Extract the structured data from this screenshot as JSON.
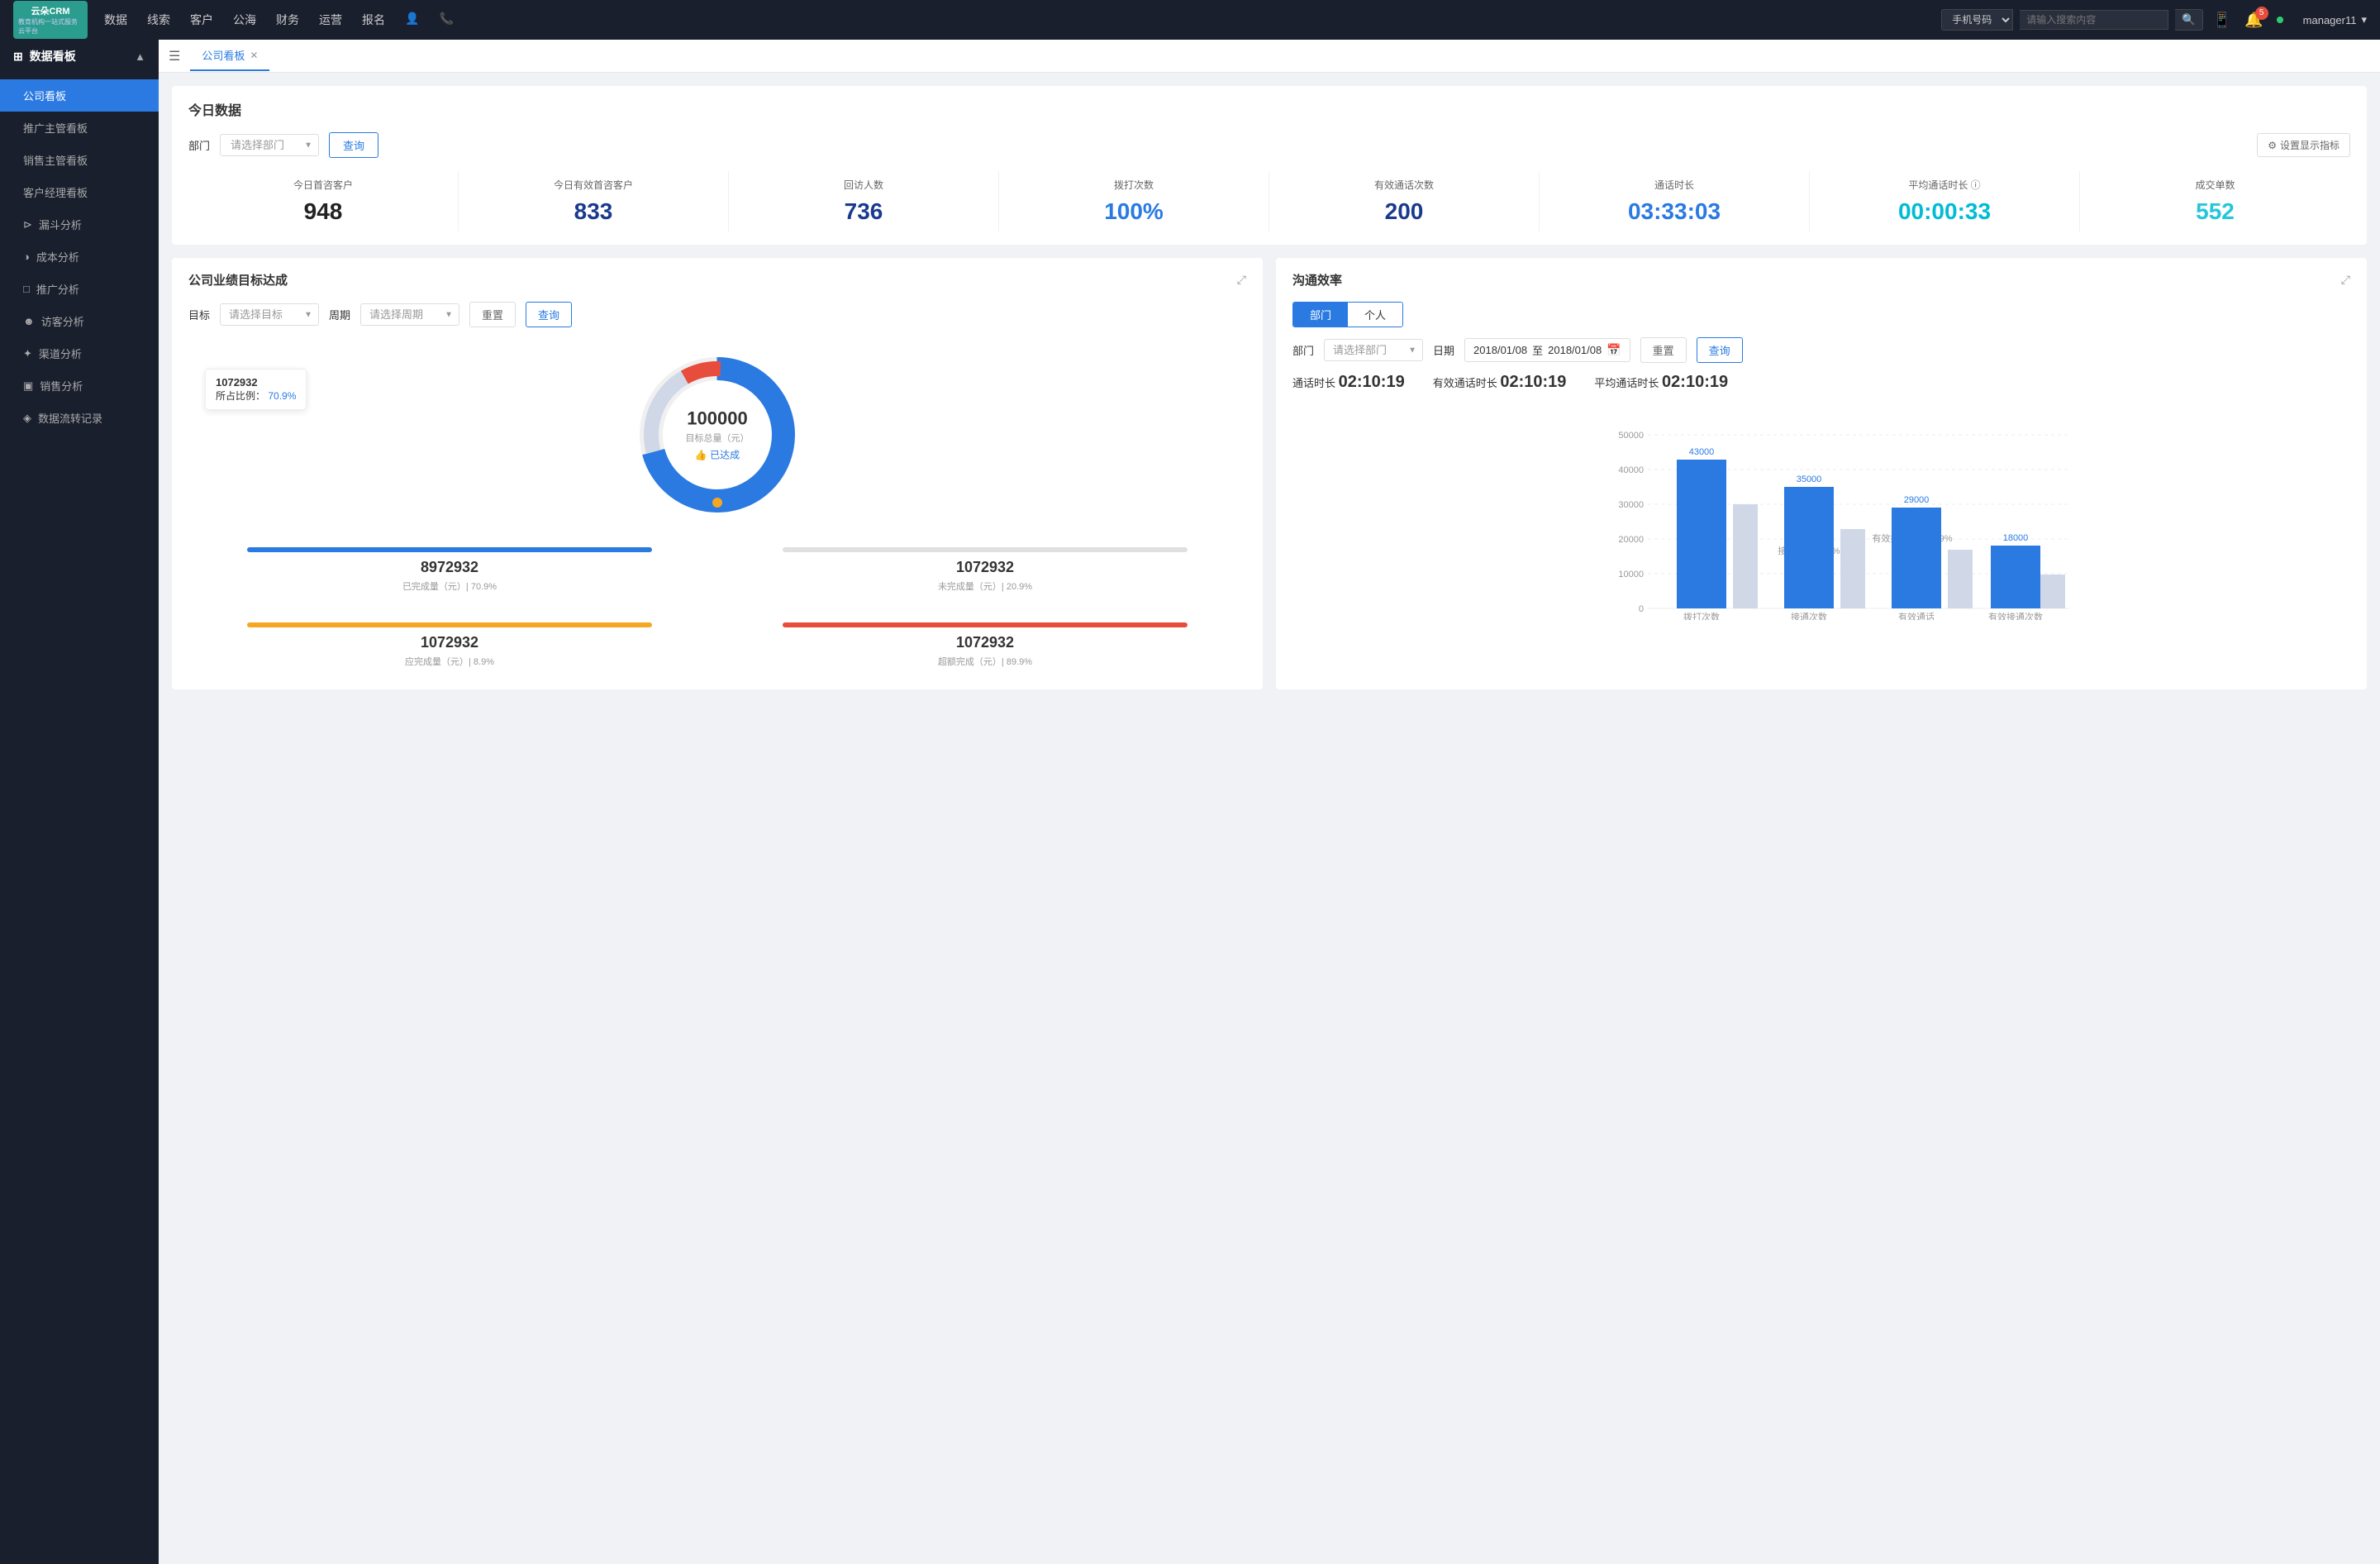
{
  "topNav": {
    "logo": {
      "text1": "云朵CRM",
      "text2": "教育机构一站式服务云平台"
    },
    "navItems": [
      "数据",
      "线索",
      "客户",
      "公海",
      "财务",
      "运营",
      "报名"
    ],
    "searchPlaceholder": "请输入搜索内容",
    "searchSelect": "手机号码",
    "notificationCount": "5",
    "username": "manager11"
  },
  "sidebar": {
    "sectionTitle": "数据看板",
    "items": [
      {
        "label": "公司看板",
        "active": true
      },
      {
        "label": "推广主管看板",
        "active": false
      },
      {
        "label": "销售主管看板",
        "active": false
      },
      {
        "label": "客户经理看板",
        "active": false
      },
      {
        "label": "漏斗分析",
        "active": false
      },
      {
        "label": "成本分析",
        "active": false
      },
      {
        "label": "推广分析",
        "active": false
      },
      {
        "label": "访客分析",
        "active": false
      },
      {
        "label": "渠道分析",
        "active": false
      },
      {
        "label": "销售分析",
        "active": false
      },
      {
        "label": "数据流转记录",
        "active": false
      }
    ]
  },
  "tab": {
    "label": "公司看板"
  },
  "todayData": {
    "sectionTitle": "今日数据",
    "filterLabel": "部门",
    "filterPlaceholder": "请选择部门",
    "queryBtn": "查询",
    "settingBtn": "设置显示指标",
    "metrics": [
      {
        "label": "今日首咨客户",
        "value": "948",
        "colorClass": "black"
      },
      {
        "label": "今日有效首咨客户",
        "value": "833",
        "colorClass": "blue-dark"
      },
      {
        "label": "回访人数",
        "value": "736",
        "colorClass": "blue-dark"
      },
      {
        "label": "拨打次数",
        "value": "100%",
        "colorClass": "blue"
      },
      {
        "label": "有效通话次数",
        "value": "200",
        "colorClass": "blue-dark"
      },
      {
        "label": "通话时长",
        "value": "03:33:03",
        "colorClass": "blue"
      },
      {
        "label": "平均通话时长",
        "value": "00:00:33",
        "colorClass": "cyan"
      },
      {
        "label": "成交单数",
        "value": "552",
        "colorClass": "teal"
      }
    ]
  },
  "goalPanel": {
    "title": "公司业绩目标达成",
    "filterGoalLabel": "目标",
    "filterGoalPlaceholder": "请选择目标",
    "filterPeriodLabel": "周期",
    "filterPeriodPlaceholder": "请选择周期",
    "resetBtn": "重置",
    "queryBtn": "查询",
    "donut": {
      "centerNum": "100000",
      "centerLabel": "目标总量（元）",
      "centerBadge": "👍 已达成",
      "tooltip": {
        "num": "1072932",
        "pctLabel": "所占比例：",
        "pct": "70.9%"
      },
      "segments": [
        {
          "color": "#2a7ae2",
          "pct": 70.9
        },
        {
          "color": "#e74c3c",
          "pct": 20
        },
        {
          "color": "#f5a623",
          "pct": 9.1
        }
      ]
    },
    "stats": [
      {
        "label": "已完成量（元）| 70.9%",
        "value": "8972932",
        "barColor": "blue"
      },
      {
        "label": "未完成量（元）| 20.9%",
        "value": "1072932",
        "barColor": "gray"
      },
      {
        "label": "应完成量（元）| 8.9%",
        "value": "1072932",
        "barColor": "yellow"
      },
      {
        "label": "超额完成（元）| 89.9%",
        "value": "1072932",
        "barColor": "red"
      }
    ]
  },
  "efficiencyPanel": {
    "title": "沟通效率",
    "tabBtns": [
      "部门",
      "个人"
    ],
    "activeTab": 0,
    "deptLabel": "部门",
    "deptPlaceholder": "请选择部门",
    "dateLabel": "日期",
    "dateFrom": "2018/01/08",
    "dateTo": "2018/01/08",
    "resetBtn": "重置",
    "queryBtn": "查询",
    "stats": {
      "callDuration": {
        "label": "通话时长",
        "value": "02:10:19"
      },
      "effectiveDuration": {
        "label": "有效通话时长",
        "value": "02:10:19"
      },
      "avgDuration": {
        "label": "平均通话时长",
        "value": "02:10:19"
      }
    },
    "chart": {
      "yLabels": [
        "0",
        "10000",
        "20000",
        "30000",
        "40000",
        "50000"
      ],
      "bars": [
        {
          "label": "拨打次数",
          "value": 43000,
          "displayVal": "43000",
          "annotationLabel": "",
          "color": "#2a7ae2"
        },
        {
          "label": "接通次数",
          "value": 35000,
          "displayVal": "35000",
          "annotationLabel": "接通率：70.9%",
          "color": "#2a7ae2"
        },
        {
          "label": "有效通话",
          "value": 29000,
          "displayVal": "29000",
          "annotationLabel": "有效接通率：70.9%",
          "color": "#2a7ae2"
        },
        {
          "label": "有效接通次数",
          "value": 18000,
          "displayVal": "18000",
          "annotationLabel": "",
          "color": "#2a7ae2"
        }
      ]
    }
  }
}
